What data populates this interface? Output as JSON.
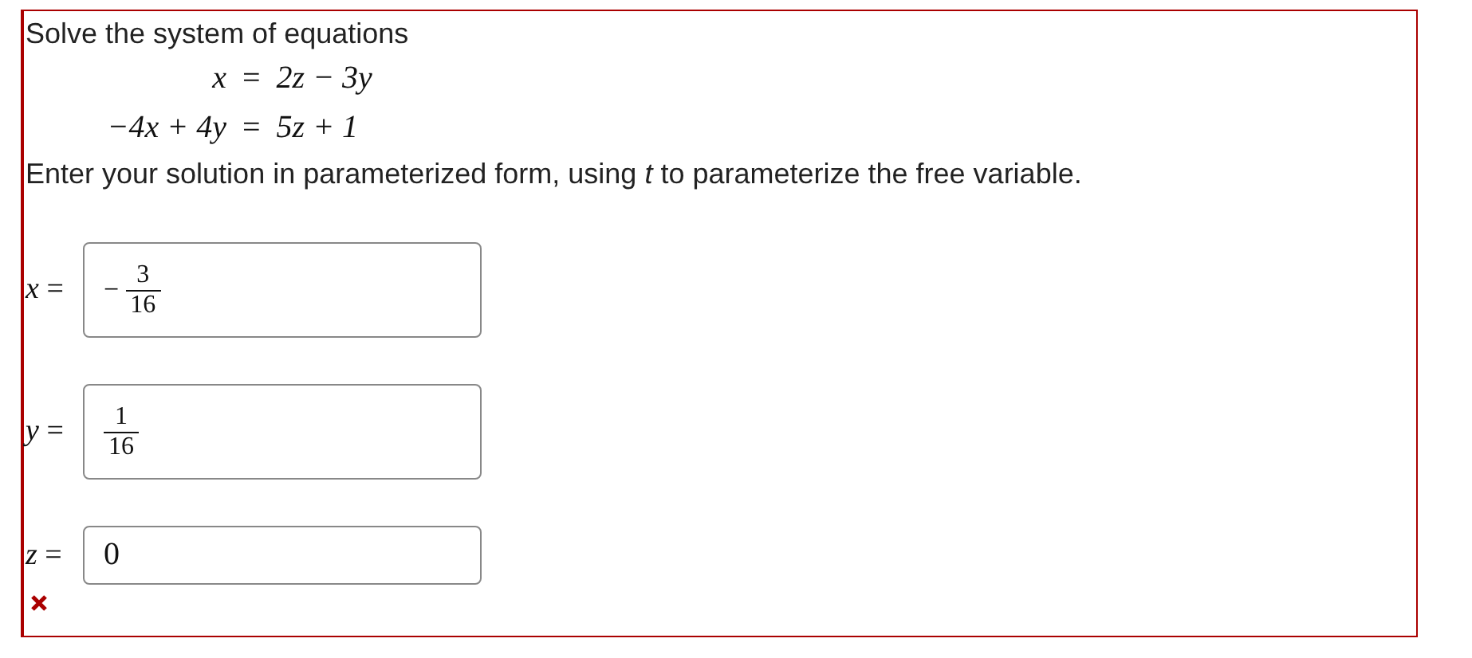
{
  "prompt": "Solve the system of equations",
  "equations": [
    {
      "lhs": "x",
      "relation": "=",
      "rhs": "2z − 3y"
    },
    {
      "lhs": "−4x + 4y",
      "relation": "=",
      "rhs": "5z + 1"
    }
  ],
  "instruction": "Enter your solution in parameterized form, using *t* to parameterize the free variable.",
  "answers": [
    {
      "variable": "x",
      "relation": "=",
      "kind": "fraction",
      "sign": "−",
      "numerator": "3",
      "denominator": "16"
    },
    {
      "variable": "y",
      "relation": "=",
      "kind": "fraction",
      "numerator": "1",
      "denominator": "16"
    },
    {
      "variable": "z",
      "relation": "=",
      "kind": "plain",
      "value": "0"
    }
  ],
  "incorrect": true
}
